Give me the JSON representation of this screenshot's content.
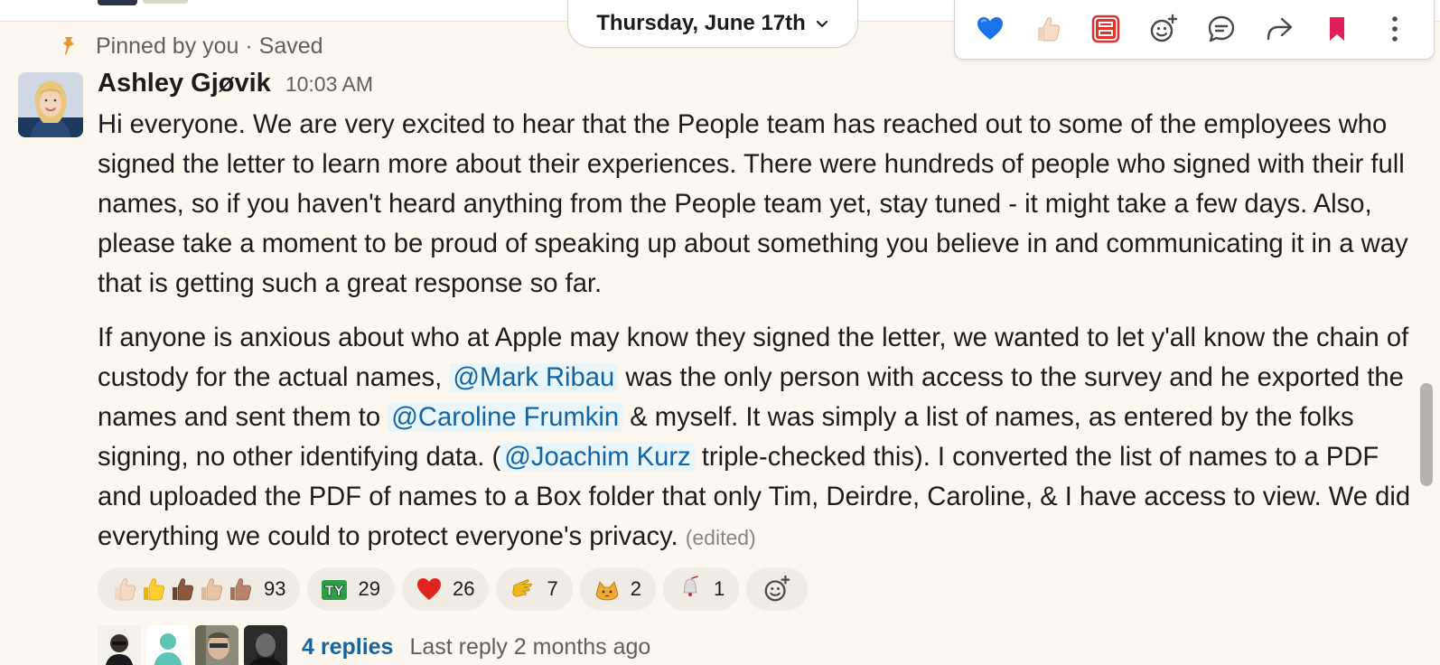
{
  "date_divider": "Thursday, June 17th",
  "toolbar": {
    "actions": [
      "blue-heart",
      "thumbs-up",
      "thank-you",
      "add-reaction",
      "reply-in-thread",
      "share",
      "save",
      "more-actions"
    ]
  },
  "pinned": {
    "text": "Pinned by you · Saved"
  },
  "message": {
    "author": "Ashley Gjøvik",
    "time": "10:03 AM",
    "p1": "Hi everyone. We are very excited to hear that the People team has reached out to some of the employees who signed the letter to learn more about their experiences. There were hundreds of people who signed with their full names, so if you haven't heard anything from the People team yet, stay tuned - it might take a few days. Also, please take a moment to be proud of speaking up about something you believe in and communicating it in a way that is getting such a great response so far.",
    "p2_a": "If anyone is anxious about who at Apple may know they signed the letter, we wanted to let y'all know the chain of custody for the actual names, ",
    "mention1": "@Mark Ribau",
    "p2_b": " was the only person with access to the survey and he exported the names and sent them to ",
    "mention2": "@Caroline Frumkin",
    "p2_c": " & myself. It was simply a list of names, as entered by the folks signing, no other identifying data. (",
    "mention3": "@Joachim Kurz",
    "p2_d": " triple-checked this). I converted the list of names to a PDF and uploaded the PDF of names to a Box folder that only Tim, Deirdre, Caroline, & I have access to view. We did everything we could to protect everyone's privacy. ",
    "edited": "(edited)"
  },
  "reactions": [
    {
      "emoji": "thumbs-up-skin-tones",
      "count": "93"
    },
    {
      "emoji": "ty",
      "count": "29"
    },
    {
      "emoji": "red-heart",
      "count": "26"
    },
    {
      "emoji": "pointing-hand",
      "count": "7"
    },
    {
      "emoji": "cat",
      "count": "2"
    },
    {
      "emoji": "bell",
      "count": "1"
    }
  ],
  "thread": {
    "replies": "4 replies",
    "last_reply": "Last reply 2 months ago"
  },
  "colors": {
    "background": "#fcf8ef",
    "link": "#1264a3",
    "mention_bg": "#e8f5fa",
    "pin": "#e8912d",
    "save": "#e01e5a"
  }
}
